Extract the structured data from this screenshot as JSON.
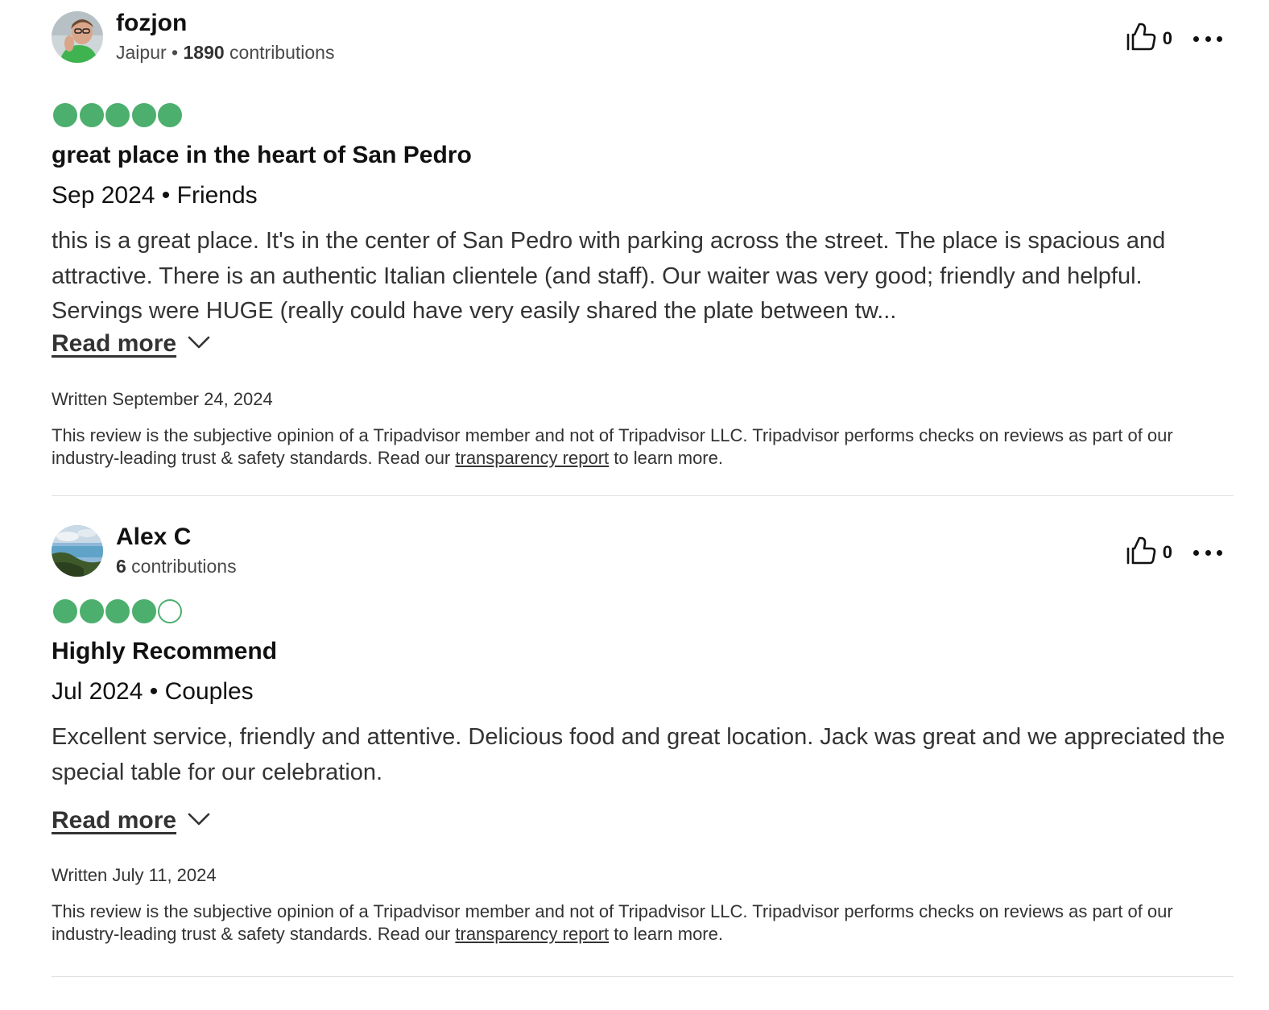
{
  "reviews": [
    {
      "user": {
        "name": "fozjon",
        "location": "Jaipur",
        "separator": " • ",
        "contributions_count": "1890",
        "contributions_label": " contributions"
      },
      "helpful_count": "0",
      "rating": 5,
      "title": "great place in the heart of San Pedro",
      "trip_info": "Sep 2024 • Friends",
      "body": "this is a great place. It's in the center of San Pedro with parking across the street. The place is spacious and attractive. There is an authentic Italian clientele (and staff). Our waiter was very good; friendly and helpful. Servings were HUGE (really could have very easily shared the plate between tw...",
      "read_more_label": "Read more",
      "written_date": "Written September 24, 2024",
      "disclaimer_prefix": "This review is the subjective opinion of a Tripadvisor member and not of Tripadvisor LLC. Tripadvisor performs checks on reviews as part of our industry-leading trust & safety standards. Read our ",
      "disclaimer_link": "transparency report",
      "disclaimer_suffix": " to learn more."
    },
    {
      "user": {
        "name": "Alex C",
        "location": "",
        "separator": "",
        "contributions_count": "6",
        "contributions_label": " contributions"
      },
      "helpful_count": "0",
      "rating": 4,
      "title": "Highly Recommend",
      "trip_info": "Jul 2024 • Couples",
      "body": "Excellent service, friendly and attentive. Delicious food and great location. Jack was great and we appreciated the special table for our celebration.",
      "read_more_label": "Read more",
      "written_date": "Written July 11, 2024",
      "disclaimer_prefix": "This review is the subjective opinion of a Tripadvisor member and not of Tripadvisor LLC. Tripadvisor performs checks on reviews as part of our industry-leading trust & safety standards. Read our ",
      "disclaimer_link": "transparency report",
      "disclaimer_suffix": " to learn more."
    }
  ],
  "colors": {
    "rating_bubble": "#4caf6e",
    "text_primary": "#111111",
    "text_secondary": "#333333",
    "divider": "#e0e0e0"
  },
  "icons": {
    "helpful": "thumbs-up-icon",
    "menu": "more-options-icon",
    "expand": "chevron-down-icon"
  }
}
